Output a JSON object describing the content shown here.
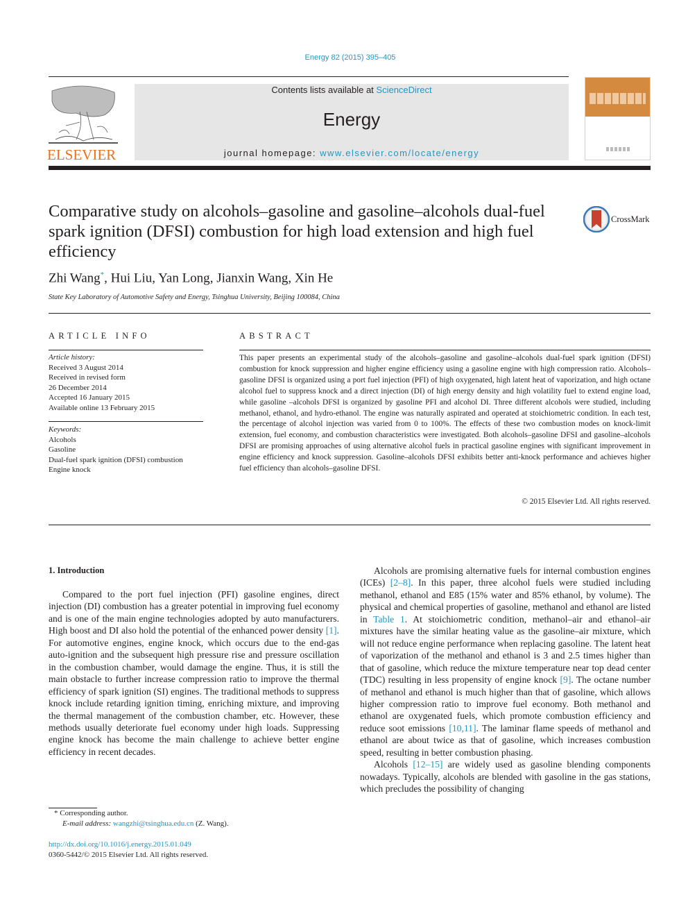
{
  "header": {
    "journal_ref": "Energy 82 (2015) 395–405",
    "contents_prefix": "Contents lists available at ",
    "contents_link": "ScienceDirect",
    "journal_name": "Energy",
    "homepage_prefix": "journal homepage: ",
    "homepage_link": "www.elsevier.com/locate/energy",
    "publisher_logo_text": "ELSEVIER",
    "brand_color": "#e9711c",
    "link_color": "#2196c4"
  },
  "article": {
    "title": "Comparative study on alcohols–gasoline and gasoline–alcohols dual-fuel spark ignition (DFSI) combustion for high load extension and high fuel efficiency",
    "crossmark_label": "CrossMark",
    "authors": [
      {
        "name": "Zhi Wang",
        "mark": "*"
      },
      {
        "name": "Hui Liu"
      },
      {
        "name": "Yan Long"
      },
      {
        "name": "Jianxin Wang"
      },
      {
        "name": "Xin He"
      }
    ],
    "affiliation": "State Key Laboratory of Automotive Safety and Energy, Tsinghua University, Beijing 100084, China"
  },
  "article_info": {
    "heading": "ARTICLE INFO",
    "history_label": "Article history:",
    "history": [
      "Received 3 August 2014",
      "Received in revised form",
      "26 December 2014",
      "Accepted 16 January 2015",
      "Available online 13 February 2015"
    ],
    "keywords_label": "Keywords:",
    "keywords": [
      "Alcohols",
      "Gasoline",
      "Dual-fuel spark ignition (DFSI) combustion",
      "Engine knock"
    ]
  },
  "abstract": {
    "heading": "ABSTRACT",
    "text": "This paper presents an experimental study of the alcohols–gasoline and gasoline–alcohols dual-fuel spark ignition (DFSI) combustion for knock suppression and higher engine efficiency using a gasoline engine with high compression ratio. Alcohols–gasoline DFSI is organized using a port fuel injection (PFI) of high oxygenated, high latent heat of vaporization, and high octane alcohol fuel to suppress knock and a direct injection (DI) of high energy density and high volatility fuel to extend engine load, while gasoline –alcohols DFSI is organized by gasoline PFI and alcohol DI. Three different alcohols were studied, including methanol, ethanol, and hydro-ethanol. The engine was naturally aspirated and operated at stoichiometric condition. In each test, the percentage of alcohol injection was varied from 0 to 100%. The effects of these two combustion modes on knock-limit extension, fuel economy, and combustion characteristics were investigated. Both alcohols–gasoline DFSI and gasoline–alcohols DFSI are promising approaches of using alternative alcohol fuels in practical gasoline engines with significant improvement in engine efficiency and knock suppression. Gasoline–alcohols DFSI exhibits better anti-knock performance and achieves higher fuel efficiency than alcohols–gasoline DFSI.",
    "copyright": "© 2015 Elsevier Ltd. All rights reserved."
  },
  "body": {
    "section_heading": "1.  Introduction",
    "left_para": [
      {
        "t": "Compared to the port fuel injection (PFI) gasoline engines, direct injection (DI) combustion has a greater potential in improving fuel economy and is one of the main engine technologies adopted by auto manufacturers. High boost and DI also hold the potential of the enhanced power density "
      },
      {
        "ref": "[1]"
      },
      {
        "t": ". For automotive engines, engine knock, which occurs due to the end-gas auto-ignition and the subsequent high pressure rise and pressure oscillation in the combustion chamber, would damage the engine. Thus, it is still the main obstacle to further increase compression ratio to improve the thermal efficiency of spark ignition (SI) engines. The traditional methods to suppress knock include retarding ignition timing, enriching mixture, and improving the thermal management of the combustion chamber, etc. However, these methods usually deteriorate fuel economy under high loads. Suppressing engine knock has become the main challenge to achieve better engine efficiency in recent decades."
      }
    ],
    "right_para1": [
      {
        "t": "Alcohols are promising alternative fuels for internal combustion engines (ICEs) "
      },
      {
        "ref": "[2–8]"
      },
      {
        "t": ". In this paper, three alcohol fuels were studied including methanol, ethanol and E85 (15% water and 85% ethanol, by volume). The physical and chemical properties of gasoline, methanol and ethanol are listed in "
      },
      {
        "ref": "Table 1"
      },
      {
        "t": ". At stoichiometric condition, methanol–air and ethanol–air mixtures have the similar heating value as the gasoline–air mixture, which will not reduce engine performance when replacing gasoline. The latent heat of vaporization of the methanol and ethanol is 3 and 2.5 times higher than that of gasoline, which reduce the mixture temperature near top dead center (TDC) resulting in less propensity of engine knock "
      },
      {
        "ref": "[9]"
      },
      {
        "t": ". The octane number of methanol and ethanol is much higher than that of gasoline, which allows higher compression ratio to improve fuel economy. Both methanol and ethanol are oxygenated fuels, which promote combustion efficiency and reduce soot emissions "
      },
      {
        "ref": "[10,11]"
      },
      {
        "t": ". The laminar flame speeds of methanol and ethanol are about twice as that of gasoline, which increases combustion speed, resulting in better combustion phasing."
      }
    ],
    "right_para2": [
      {
        "t": "Alcohols "
      },
      {
        "ref": "[12–15]"
      },
      {
        "t": " are widely used as gasoline blending components nowadays. Typically, alcohols are blended with gasoline in the gas stations, which precludes the possibility of changing"
      }
    ]
  },
  "footnotes": {
    "corresponding": "* Corresponding author.",
    "email_label": "E-mail address: ",
    "email": "wangzhi@tsinghua.edu.cn",
    "email_suffix": " (Z. Wang).",
    "doi": "http://dx.doi.org/10.1016/j.energy.2015.01.049",
    "issn": "0360-5442/© 2015 Elsevier Ltd. All rights reserved."
  }
}
